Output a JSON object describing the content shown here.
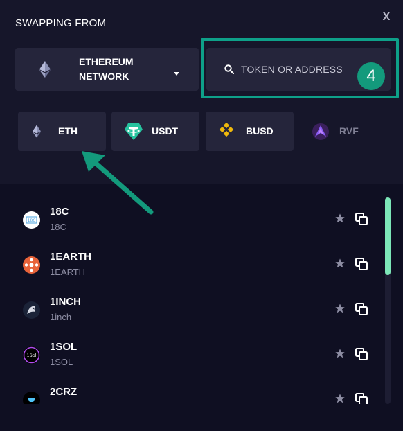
{
  "header": {
    "title": "SWAPPING FROM",
    "close_label": "X"
  },
  "network_selector": {
    "label": "ETHEREUM NETWORK",
    "icon": "ethereum-icon"
  },
  "search": {
    "placeholder": "TOKEN OR ADDRESS",
    "value": ""
  },
  "step_badge": "4",
  "quick_tokens": [
    {
      "symbol": "ETH",
      "icon": "ethereum-icon"
    },
    {
      "symbol": "USDT",
      "icon": "tether-icon"
    },
    {
      "symbol": "BUSD",
      "icon": "binance-icon"
    },
    {
      "symbol": "RVF",
      "icon": "rvf-icon"
    }
  ],
  "token_list": [
    {
      "symbol": "18C",
      "name": "18C"
    },
    {
      "symbol": "1EARTH",
      "name": "1EARTH"
    },
    {
      "symbol": "1INCH",
      "name": "1inch"
    },
    {
      "symbol": "1SOL",
      "name": "1SOL"
    },
    {
      "symbol": "2CRZ",
      "name": ""
    }
  ],
  "token_logo_texts": {
    "t18c": "18C",
    "t1sol": "1Sol"
  },
  "colors": {
    "background": "#0f0f22",
    "panel": "#16162a",
    "control": "#25253b",
    "accent_green": "#0ea089",
    "scrollbar": "#7ce6b8"
  }
}
